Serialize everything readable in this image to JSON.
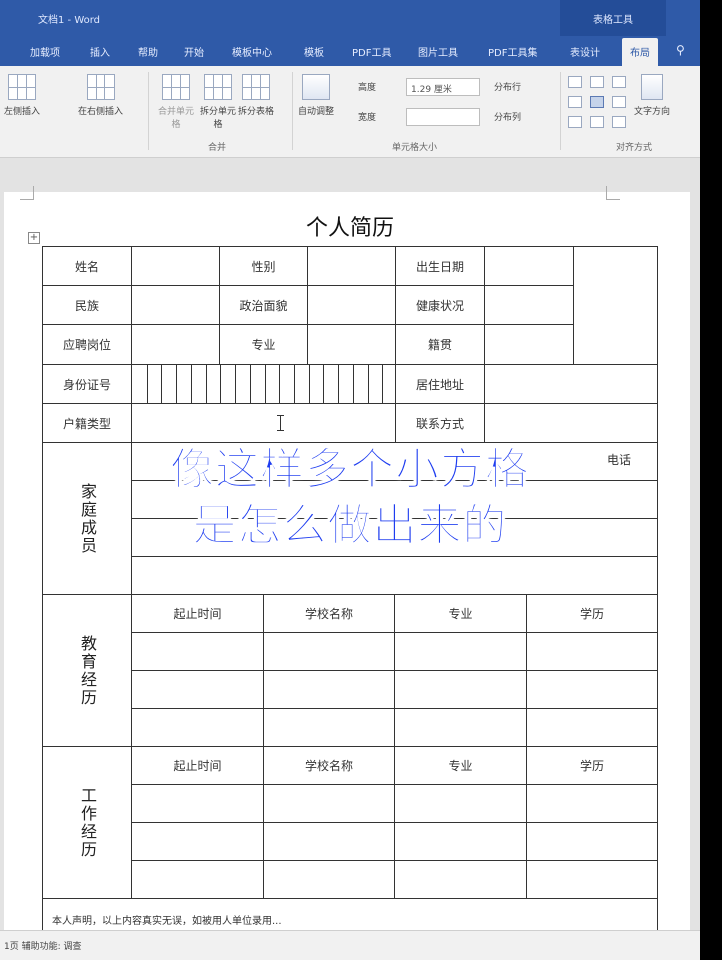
{
  "window": {
    "title": "文档1 - Word",
    "context_tab": "表格工具"
  },
  "ribbon_tabs": [
    "加载项",
    "插入",
    "帮助",
    "开始",
    "模板中心",
    "模板",
    "PDF工具",
    "图片工具",
    "PDF工具集",
    "表设计",
    "布局"
  ],
  "active_tab": "布局",
  "ribbon": {
    "insert_left": "左侧插入",
    "insert_right": "在右侧插入",
    "merge_cells": "合并单元格",
    "split_cells": "拆分单元格",
    "split_table": "拆分表格",
    "merge_group": "合并",
    "autofit": "自动调整",
    "height_label": "高度",
    "height_value": "1.29 厘米",
    "width_label": "宽度",
    "distribute_rows": "分布行",
    "distribute_cols": "分布列",
    "cell_size_group": "单元格大小",
    "text_direction": "文字方向",
    "align_group": "对齐方式"
  },
  "document": {
    "title": "个人简历",
    "rows": {
      "name": "姓名",
      "gender": "性别",
      "birth": "出生日期",
      "ethnicity": "民族",
      "political": "政治面貌",
      "health": "健康状况",
      "position": "应聘岗位",
      "major": "专业",
      "origin": "籍贯",
      "id_number": "身份证号",
      "address": "居住地址",
      "hukou": "户籍类型",
      "contact": "联系方式"
    },
    "family": {
      "label": "家庭成员",
      "col_phone": "电话"
    },
    "education": {
      "label": "教育经历",
      "headers": [
        "起止时间",
        "学校名称",
        "专业",
        "学历"
      ]
    },
    "work": {
      "label": "工作经历",
      "headers": [
        "起止时间",
        "学校名称",
        "专业",
        "学历"
      ]
    },
    "footer_note": "本人声明，以上内容真实无误，如被用人单位录用..."
  },
  "caption": {
    "line1": "像这样多个小方格",
    "line2": "是怎么做出来的"
  },
  "status": "1页 辅助功能: 调查"
}
